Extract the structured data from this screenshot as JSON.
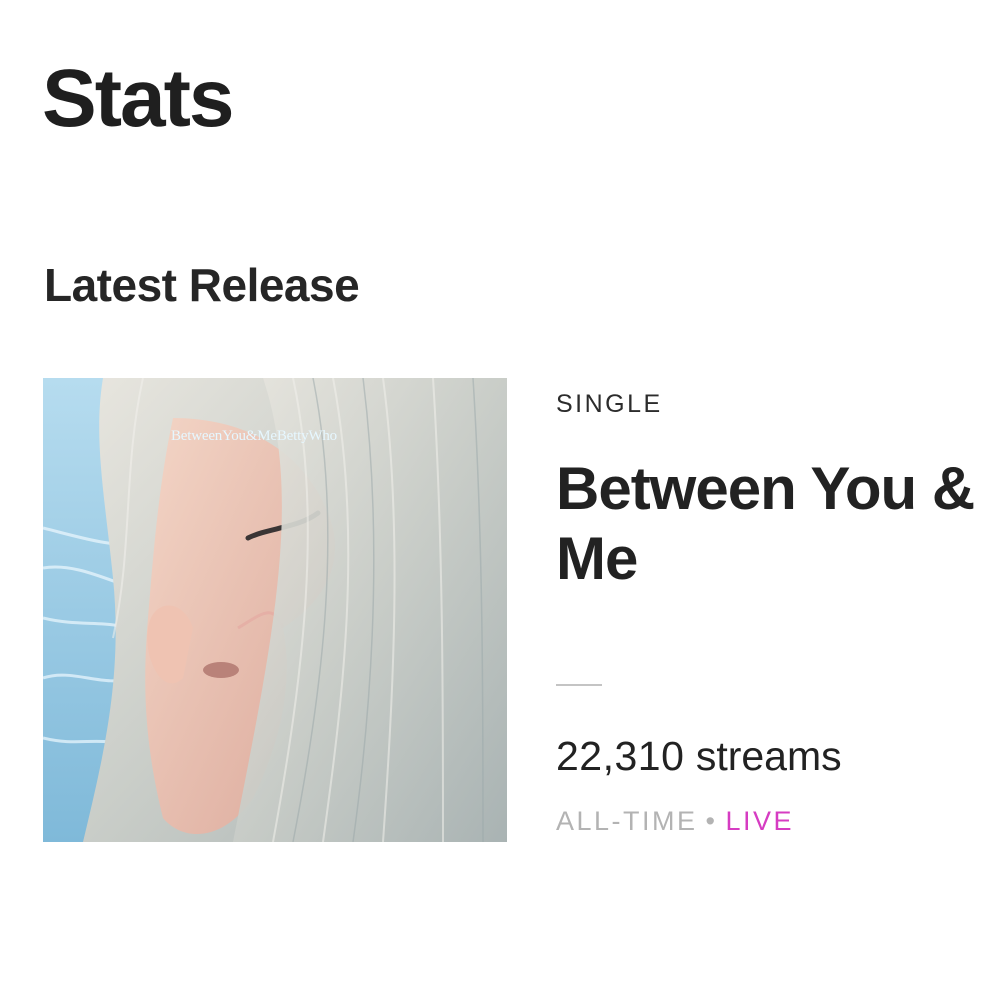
{
  "page": {
    "title": "Stats"
  },
  "latest_release": {
    "section_title": "Latest Release",
    "cover_art": {
      "text": "BetweenYou&MeBettyWho"
    },
    "type": "SINGLE",
    "title": "Between You & Me",
    "streams_count": "22,310",
    "streams_unit": "streams",
    "period": "ALL-TIME",
    "separator": "•",
    "status": "LIVE"
  },
  "colors": {
    "live_accent": "#d63cc2",
    "muted_text": "#b3b3b3",
    "divider": "#c4c4c4"
  }
}
